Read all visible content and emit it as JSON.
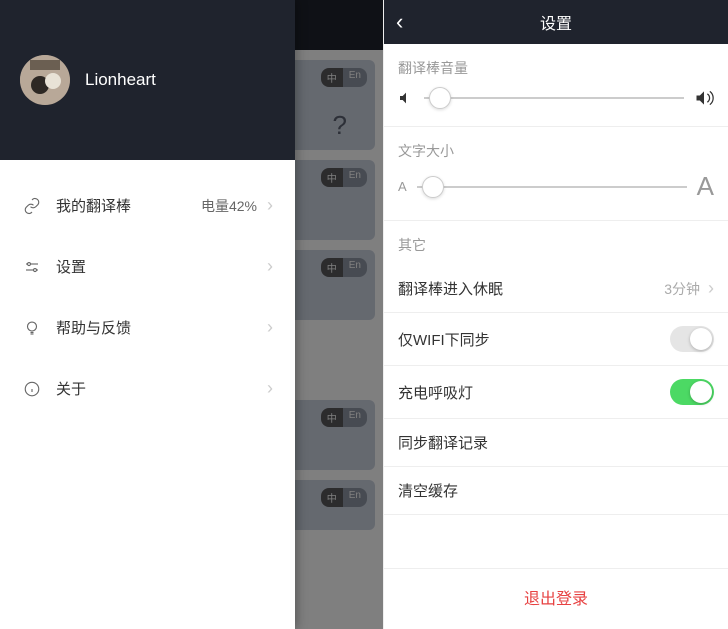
{
  "drawer": {
    "username": "Lionheart",
    "menu": [
      {
        "label": "我的翻译棒",
        "right": "电量42%"
      },
      {
        "label": "设置",
        "right": ""
      },
      {
        "label": "帮助与反馈",
        "right": ""
      },
      {
        "label": "关于",
        "right": ""
      }
    ]
  },
  "bg": {
    "pill_a": "中",
    "pill_b": "En",
    "q": "?"
  },
  "settings": {
    "title": "设置",
    "volume_label": "翻译棒音量",
    "volume_percent": 5,
    "font_label": "文字大小",
    "font_percent": 5,
    "small_a": "A",
    "big_a": "A",
    "other_label": "其它",
    "sleep_label": "翻译棒进入休眠",
    "sleep_value": "3分钟",
    "wifi_label": "仅WIFI下同步",
    "wifi_on": false,
    "breath_label": "充电呼吸灯",
    "breath_on": true,
    "sync_label": "同步翻译记录",
    "clear_label": "清空缓存",
    "logout": "退出登录"
  }
}
